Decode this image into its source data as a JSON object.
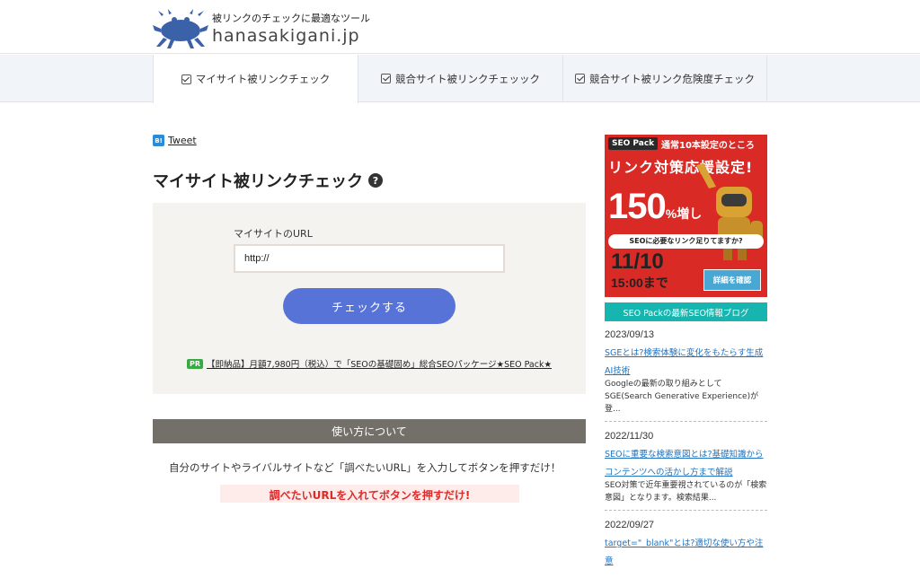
{
  "header": {
    "tagline": "被リンクのチェックに最適なツール",
    "domain": "hanasakigani.jp"
  },
  "nav": {
    "tabs": [
      {
        "label": "マイサイト被リンクチェック"
      },
      {
        "label": "競合サイト被リンクチェッック"
      },
      {
        "label": "競合サイト被リンク危険度チェック"
      }
    ]
  },
  "share": {
    "hatena": "B!",
    "tweet": "Tweet"
  },
  "main": {
    "title": "マイサイト被リンクチェック",
    "help": "?",
    "form": {
      "url_label": "マイサイトのURL",
      "url_value": "http://",
      "check_button": "チェックする"
    },
    "pr": {
      "badge": "PR",
      "text": "【即納品】月額7,980円（税込）で「SEOの基礎固め」総合SEOパッケージ★SEO Pack★"
    },
    "howto": {
      "heading": "使い方について",
      "text": "自分のサイトやライバルサイトなど「調べたいURL」を入力してボタンを押すだけ！",
      "banner": "調べたいURLを入れてボタンを押すだけ!"
    }
  },
  "sidebar": {
    "ad": {
      "logo": "SEO Pack",
      "top_text": "通常10本設定のところ",
      "headline": "リンク対策応援設定!",
      "big": "150",
      "big_suffix": "%増し",
      "sub": "SEOに必要なリンク足りてますか?",
      "date": "11/10",
      "time": "15:00まで",
      "detail": "詳細を確認"
    },
    "blog_heading": "SEO Packの最新SEO情報ブログ",
    "posts": [
      {
        "date": "2023/09/13",
        "title": "SGEとは?検索体験に変化をもたらす生成AI技術",
        "excerpt": "Googleの最新の取り組みとしてSGE(Search Generative Experience)が登..."
      },
      {
        "date": "2022/11/30",
        "title": "SEOに重要な検索意図とは?基礎知識からコンテンツへの活かし方まで解説",
        "excerpt": "SEO対策で近年重要視されているのが「検索意図」となります。検索結果..."
      },
      {
        "date": "2022/09/27",
        "title": "target=\"_blank\"とは?適切な使い方や注意",
        "excerpt": ""
      }
    ]
  },
  "colors": {
    "primary_button": "#5873d8",
    "section_bar": "#727068",
    "blog_heading": "#16b5b0",
    "ad_red": "#d92a26",
    "pr_badge": "#3aa843",
    "link": "#1f73c0"
  }
}
